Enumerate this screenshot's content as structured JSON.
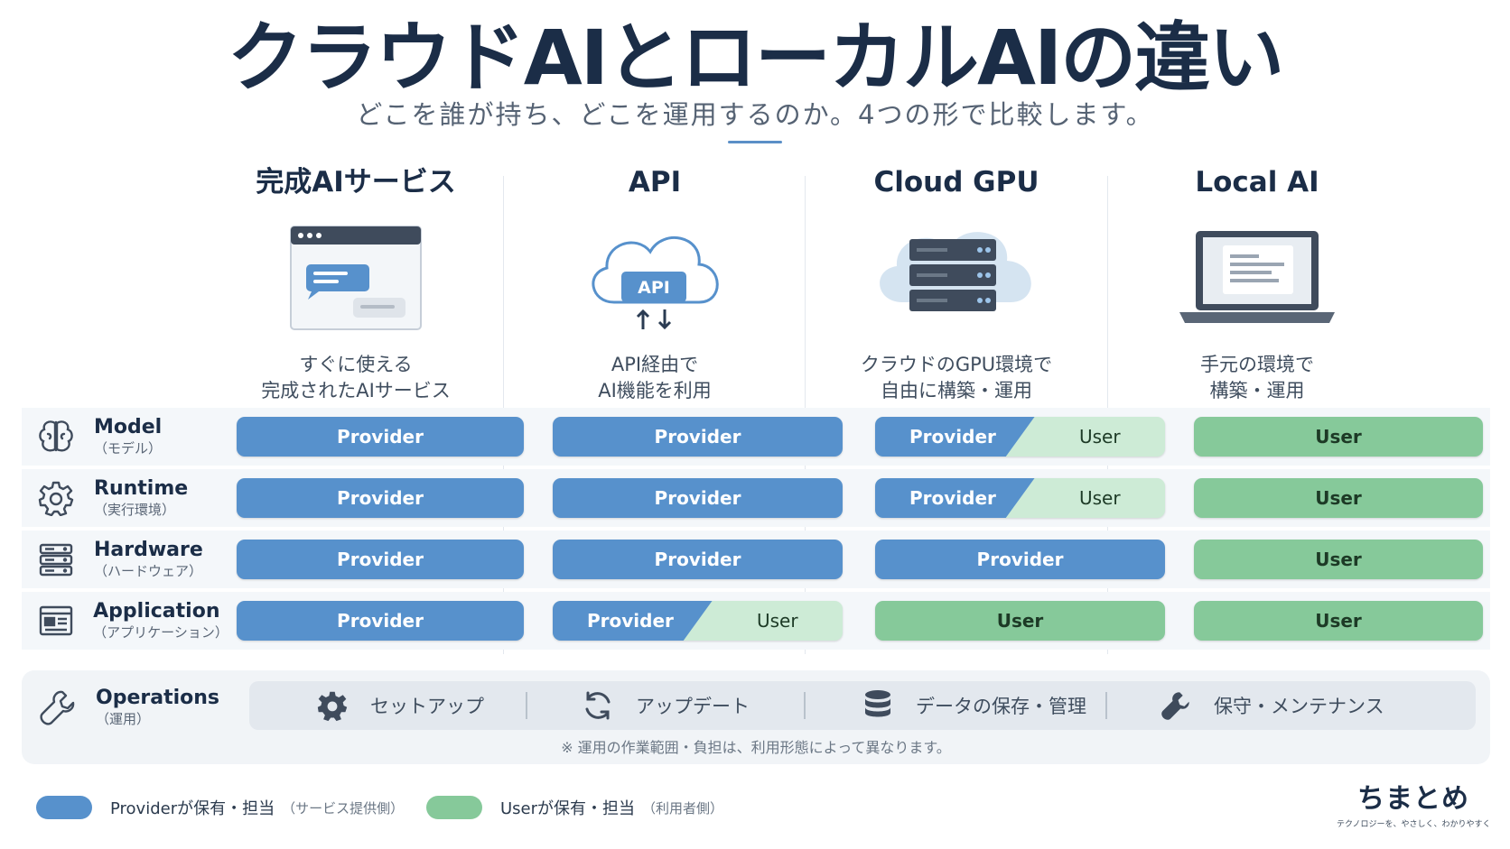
{
  "title": "クラウドAIとローカルAIの違い",
  "subtitle": "どこを誰が持ち、どこを運用するのか。4つの形で比較します。",
  "columns": [
    {
      "title": "完成AIサービス",
      "desc_line1": "すぐに使える",
      "desc_line2": "完成されたAIサービス",
      "illustration_label": ""
    },
    {
      "title": "API",
      "desc_line1": "API経由で",
      "desc_line2": "AI機能を利用",
      "illustration_label": "API"
    },
    {
      "title": "Cloud GPU",
      "desc_line1": "クラウドのGPU環境で",
      "desc_line2": "自由に構築・運用",
      "illustration_label": ""
    },
    {
      "title": "Local AI",
      "desc_line1": "手元の環境で",
      "desc_line2": "構築・運用",
      "illustration_label": ""
    }
  ],
  "rows": [
    {
      "label": "Model",
      "sublabel": "（モデル）",
      "icon": "brain-icon",
      "cells": [
        {
          "type": "provider"
        },
        {
          "type": "provider"
        },
        {
          "type": "split"
        },
        {
          "type": "user"
        }
      ]
    },
    {
      "label": "Runtime",
      "sublabel": "（実行環境）",
      "icon": "gear-icon",
      "cells": [
        {
          "type": "provider"
        },
        {
          "type": "provider"
        },
        {
          "type": "split"
        },
        {
          "type": "user"
        }
      ]
    },
    {
      "label": "Hardware",
      "sublabel": "（ハードウェア）",
      "icon": "server-icon",
      "cells": [
        {
          "type": "provider"
        },
        {
          "type": "provider"
        },
        {
          "type": "provider"
        },
        {
          "type": "user"
        }
      ]
    },
    {
      "label": "Application",
      "sublabel": "（アプリケーション）",
      "icon": "app-window-icon",
      "cells": [
        {
          "type": "provider"
        },
        {
          "type": "split"
        },
        {
          "type": "user"
        },
        {
          "type": "user"
        }
      ]
    }
  ],
  "labels": {
    "provider": "Provider",
    "user": "User"
  },
  "operations": {
    "label": "Operations",
    "sublabel": "（運用）",
    "icon": "wrench-icon",
    "items": [
      {
        "icon": "gear-icon",
        "label": "セットアップ"
      },
      {
        "icon": "refresh-icon",
        "label": "アップデート"
      },
      {
        "icon": "database-icon",
        "label": "データの保存・管理"
      },
      {
        "icon": "wrench-icon",
        "label": "保守・メンテナンス"
      }
    ],
    "note": "※ 運用の作業範囲・負担は、利用形態によって異なります。"
  },
  "legend": [
    {
      "color": "#5791cc",
      "label": "Providerが保有・担当",
      "sublabel": "（サービス提供側）"
    },
    {
      "color": "#86c99a",
      "label": "Userが保有・担当",
      "sublabel": "（利用者側）"
    }
  ],
  "brand": {
    "name": "ちまとめ",
    "tagline": "テクノロジーを、やさしく、わかりやすく"
  },
  "colors": {
    "provider": "#5791cc",
    "user": "#86c99a",
    "user_light": "#cdebd6",
    "title": "#1b2d47"
  }
}
